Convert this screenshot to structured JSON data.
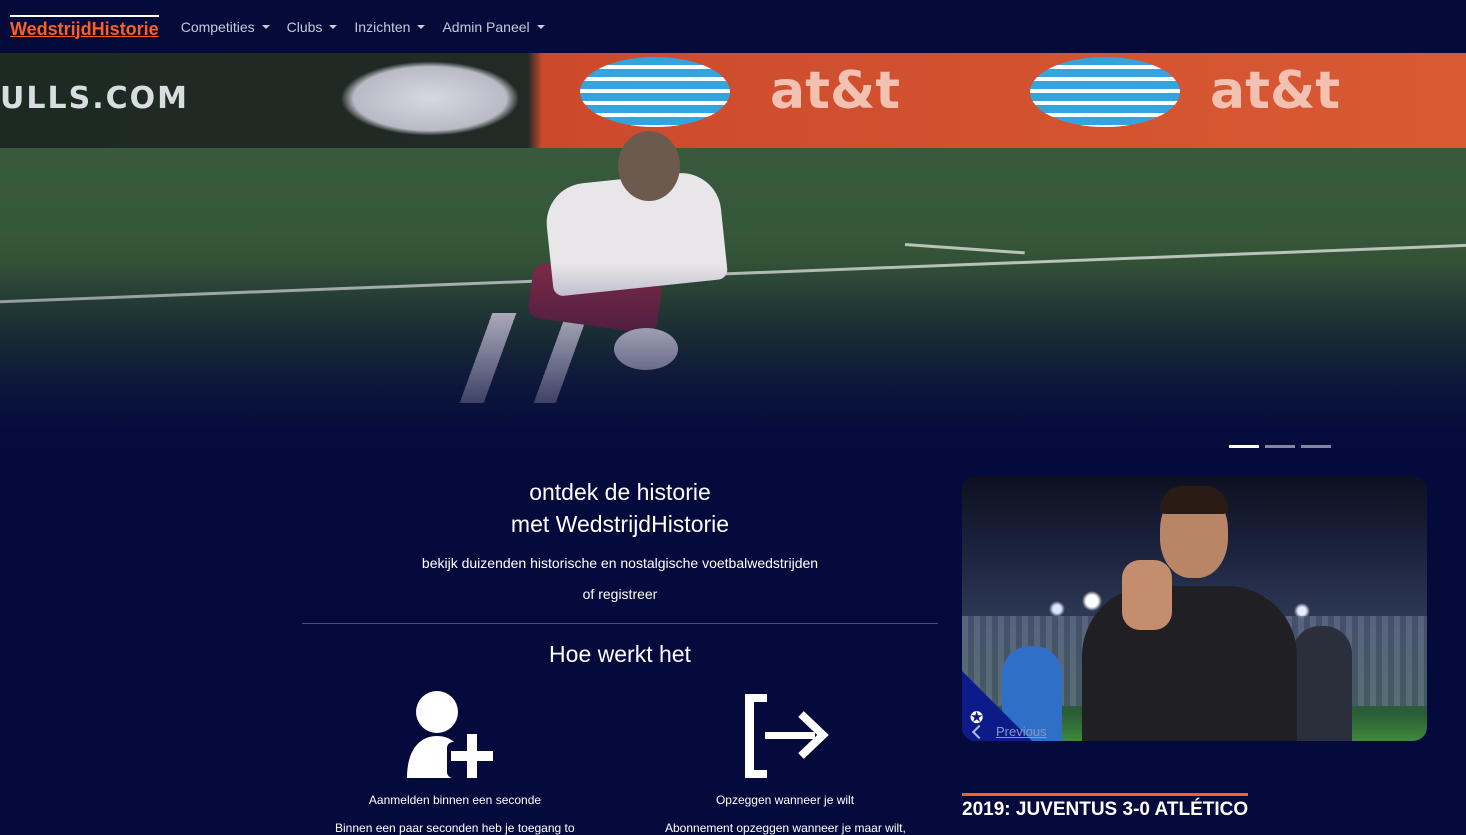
{
  "navbar": {
    "brand": "WedstrijdHistorie",
    "items": [
      {
        "label": "Competities"
      },
      {
        "label": "Clubs"
      },
      {
        "label": "Inzichten"
      },
      {
        "label": "Admin Paneel"
      }
    ]
  },
  "hero": {
    "board_text": "ULLS.COM",
    "sponsor_text": "at&t",
    "indicator_count": 3,
    "active_indicator": 1
  },
  "intro": {
    "title_line1": "ontdek de historie",
    "title_line2": "met WedstrijdHistorie",
    "subtitle": "bekijk duizenden historische en nostalgische voetbalwedstrijden",
    "register_link": "of registreer"
  },
  "how_it_works": {
    "title": "Hoe werkt het",
    "steps": [
      {
        "caption": "Aanmelden binnen een seconde",
        "desc": "Binnen een paar seconden heb je toegang tot alle wedstrijden",
        "icon": "user-plus-icon"
      },
      {
        "caption": "Opzeggen wanneer je wilt",
        "desc": "Abonnement opzeggen wanneer je maar wilt, zonder gedoe",
        "icon": "sign-out-icon"
      }
    ]
  },
  "news": {
    "prev_label": "Previous",
    "headline": "2019: JUVENTUS 3-0 ATLÉTICO"
  },
  "colors": {
    "background": "#050a3d",
    "navbar": "#040a3a",
    "brand": "#ff5f1f",
    "accent": "#ff5f1f"
  }
}
